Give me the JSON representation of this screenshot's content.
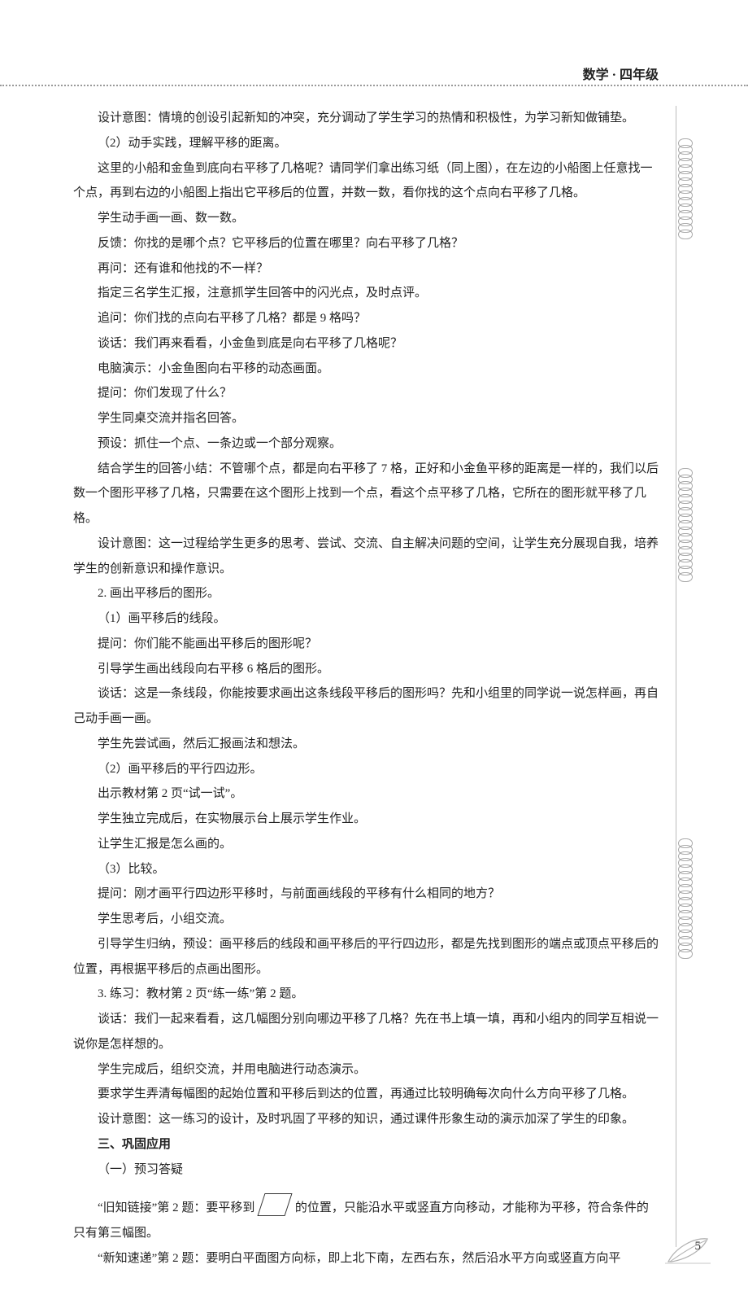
{
  "header": {
    "subject": "数学",
    "dot": "·",
    "grade": "四年级"
  },
  "paragraphs": {
    "p01": "设计意图：情境的创设引起新知的冲突，充分调动了学生学习的热情和积极性，为学习新知做铺垫。",
    "p02": "（2）动手实践，理解平移的距离。",
    "p03": "这里的小船和金鱼到底向右平移了几格呢？请同学们拿出练习纸（同上图），在左边的小船图上任意找一个点，再到右边的小船图上指出它平移后的位置，并数一数，看你找的这个点向右平移了几格。",
    "p04": "学生动手画一画、数一数。",
    "p05": "反馈：你找的是哪个点？它平移后的位置在哪里？向右平移了几格？",
    "p06": "再问：还有谁和他找的不一样？",
    "p07": "指定三名学生汇报，注意抓学生回答中的闪光点，及时点评。",
    "p08": "追问：你们找的点向右平移了几格？都是 9 格吗？",
    "p09": "谈话：我们再来看看，小金鱼到底是向右平移了几格呢？",
    "p10": "电脑演示：小金鱼图向右平移的动态画面。",
    "p11": "提问：你们发现了什么？",
    "p12": "学生同桌交流并指名回答。",
    "p13": "预设：抓住一个点、一条边或一个部分观察。",
    "p14": "结合学生的回答小结：不管哪个点，都是向右平移了 7 格，正好和小金鱼平移的距离是一样的，我们以后数一个图形平移了几格，只需要在这个图形上找到一个点，看这个点平移了几格，它所在的图形就平移了几格。",
    "p15": "设计意图：这一过程给学生更多的思考、尝试、交流、自主解决问题的空间，让学生充分展现自我，培养学生的创新意识和操作意识。",
    "p16": "2. 画出平移后的图形。",
    "p17": "（1）画平移后的线段。",
    "p18": "提问：你们能不能画出平移后的图形呢？",
    "p19": "引导学生画出线段向右平移 6 格后的图形。",
    "p20": "谈话：这是一条线段，你能按要求画出这条线段平移后的图形吗？先和小组里的同学说一说怎样画，再自己动手画一画。",
    "p21": "学生先尝试画，然后汇报画法和想法。",
    "p22": "（2）画平移后的平行四边形。",
    "p23": "出示教材第 2 页“试一试”。",
    "p24": "学生独立完成后，在实物展示台上展示学生作业。",
    "p25": "让学生汇报是怎么画的。",
    "p26": "（3）比较。",
    "p27": "提问：刚才画平行四边形平移时，与前面画线段的平移有什么相同的地方？",
    "p28": "学生思考后，小组交流。",
    "p29": "引导学生归纳，预设：画平移后的线段和画平移后的平行四边形，都是先找到图形的端点或顶点平移后的位置，再根据平移后的点画出图形。",
    "p30": "3. 练习：教材第 2 页“练一练”第 2 题。",
    "p31": "谈话：我们一起来看看，这几幅图分别向哪边平移了几格？先在书上填一填，再和小组内的同学互相说一说你是怎样想的。",
    "p32": "学生完成后，组织交流，并用电脑进行动态演示。",
    "p33": "要求学生弄清每幅图的起始位置和平移后到达的位置，再通过比较明确每次向什么方向平移了几格。",
    "p34": "设计意图：这一练习的设计，及时巩固了平移的知识，通过课件形象生动的演示加深了学生的印象。",
    "p35": "三、巩固应用",
    "p36": "（一）预习答疑",
    "p37a": "“旧知链接”第 2 题：要平移到",
    "p37b": "的位置，只能沿水平或竖直方向移动，才能称为平移，符合条件的只有第三幅图。",
    "p38": "“新知速递”第 2 题：要明白平面图方向标，即上北下南，左西右东，然后沿水平方向或竖直方向平"
  },
  "pageNumber": "5"
}
